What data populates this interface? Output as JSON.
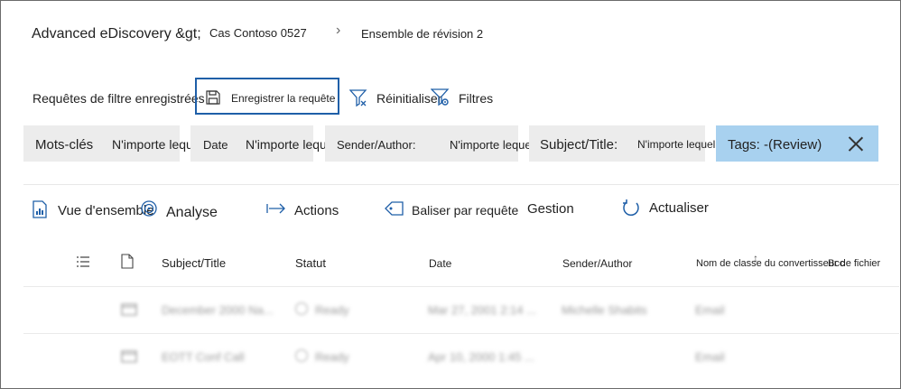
{
  "breadcrumb": {
    "root": "Advanced eDiscovery &gt;",
    "case": "Cas Contoso 0527",
    "separator": "›",
    "current": "Ensemble de révision 2"
  },
  "filter_bar": {
    "saved_queries_label": "Requêtes de filtre enregistrées",
    "save_query_label": "Enregistrer la requête",
    "reset_label": "Réinitialiser",
    "filters_label": "Filtres"
  },
  "chips": {
    "keywords_label": "Mots-clés",
    "keywords_value": "N'importe lequel",
    "date_label": "Date",
    "date_value": "N'importe lequel",
    "sender_label": "Sender/Author:",
    "sender_value": "N'importe lequel",
    "subject_label": "Subject/Title:",
    "subject_value": "N'importe lequel",
    "tags_label": "Tags: -(Review)"
  },
  "toolbar": {
    "overview": "Vue d'ensemble",
    "analysis": "Analyse",
    "actions": "Actions",
    "tag_by_query": "Baliser par requête",
    "manage": "Gestion",
    "refresh": "Actualiser"
  },
  "table": {
    "columns": {
      "subject": "Subject/Title",
      "status": "Statut",
      "date": "Date",
      "sender": "Sender/Author",
      "class_name": "Nom de classe du convertisseur de fichier",
      "extra": "Bcc"
    },
    "rows": [
      {
        "subject": "December 2000 Na...",
        "status": "Ready",
        "date": "Mar 27, 2001 2:14 ...",
        "sender": "Michelle Shabits",
        "class": "Email"
      },
      {
        "subject": "EOTT Conf Call",
        "status": "Ready",
        "date": "Apr 10, 2000 1:45 ...",
        "sender": "",
        "class": "Email"
      }
    ]
  },
  "colors": {
    "accent": "#1f5fa8",
    "chip_bg": "#ececec",
    "tags_chip_bg": "#a8d1ef"
  }
}
